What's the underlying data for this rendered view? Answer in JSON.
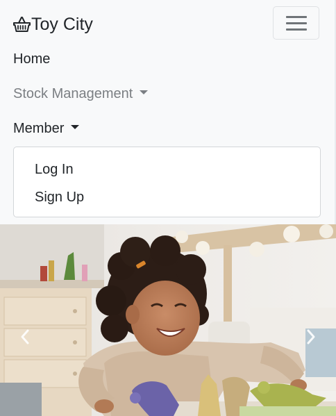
{
  "navbar": {
    "brand_label": "Toy City",
    "brand_icon": "basket-icon",
    "toggler_icon": "hamburger-menu-icon",
    "items": [
      {
        "label": "Home"
      },
      {
        "label": "Stock Management",
        "dropdown": true
      },
      {
        "label": "Member",
        "dropdown": true,
        "expanded": true
      }
    ],
    "member_menu": [
      {
        "label": "Log In"
      },
      {
        "label": "Sign Up"
      }
    ]
  },
  "carousel": {
    "prev_icon": "chevron-left-icon",
    "next_icon": "chevron-right-icon",
    "image_icon": "child-playing-with-toys-photo"
  },
  "colors": {
    "navbar_bg": "#f8f9fa",
    "text": "#212529",
    "muted_text": "#7b7f83"
  }
}
